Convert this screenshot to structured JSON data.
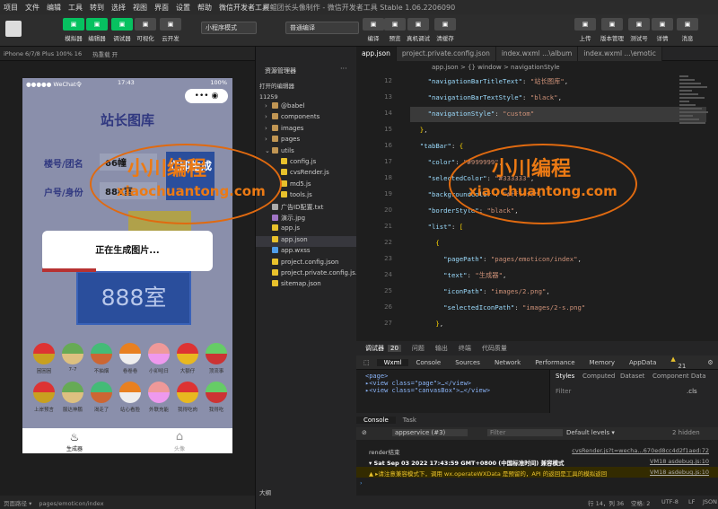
{
  "menu": [
    "项目",
    "文件",
    "编辑",
    "工具",
    "转到",
    "选择",
    "视图",
    "界面",
    "设置",
    "帮助",
    "微信开发者工具"
  ],
  "window_title": "腥鲲团长头像制作 - 微信开发者工具 Stable 1.06.2206090",
  "toolbar": {
    "left": [
      "模拟器",
      "编辑器",
      "调试器",
      "可视化",
      "云开发"
    ],
    "mode_select": "小程序模式",
    "compile_select": "普通编译",
    "center": [
      "编译",
      "预览",
      "真机调试",
      "清缓存"
    ],
    "right": [
      "上传",
      "版本管理",
      "测试号",
      "详情",
      "消息"
    ]
  },
  "simulator": {
    "device": "iPhone 6/7/8 Plus 100% 16",
    "hot_reload": "热重载 开",
    "status": {
      "carrier": "●●●●● WeChat令",
      "time": "17:43",
      "battery": "100%"
    },
    "page_title": "站长图库",
    "field1": {
      "label": "楼号/团名",
      "value": "66幢"
    },
    "field2": {
      "label": "户号/身份",
      "value": "888室"
    },
    "generate_button": "立即生成",
    "preview_text": "888室",
    "toast_text": "正在生成图片...",
    "emoji_row1": [
      "困困困",
      "7-7",
      "不抽烟",
      "卷卷卷",
      "小卯哈日",
      "大额仔",
      "顶流事"
    ],
    "emoji_row2": [
      "上岸预言",
      "服达神鹏",
      "渴走了",
      "站心看脸",
      "外联充能",
      "我得吃肉",
      "我得吃"
    ],
    "tab_left": "生成器",
    "tab_right": "头像"
  },
  "sim_footer": {
    "path_label": "页面路径 ▾",
    "path": "pages/emoticon/index"
  },
  "explorer": {
    "title": "资源管理器",
    "open_editors": "打开的编辑器",
    "root": "11259",
    "items": [
      {
        "name": "@babel",
        "type": "folder",
        "indent": 1
      },
      {
        "name": "components",
        "type": "folder",
        "indent": 1
      },
      {
        "name": "images",
        "type": "folder",
        "indent": 1
      },
      {
        "name": "pages",
        "type": "folder",
        "indent": 1
      },
      {
        "name": "utils",
        "type": "folder-open",
        "indent": 1
      },
      {
        "name": "config.js",
        "type": "js",
        "indent": 2
      },
      {
        "name": "cvsRender.js",
        "type": "js",
        "indent": 2
      },
      {
        "name": "md5.js",
        "type": "js",
        "indent": 2
      },
      {
        "name": "tools.js",
        "type": "js",
        "indent": 2
      },
      {
        "name": "广告ID配置.txt",
        "type": "txt",
        "indent": 1
      },
      {
        "name": "演示.jpg",
        "type": "img",
        "indent": 1
      },
      {
        "name": "app.js",
        "type": "js",
        "indent": 1
      },
      {
        "name": "app.json",
        "type": "json",
        "indent": 1
      },
      {
        "name": "app.wxss",
        "type": "wxss",
        "indent": 1
      },
      {
        "name": "project.config.json",
        "type": "json",
        "indent": 1
      },
      {
        "name": "project.private.config.js...",
        "type": "json",
        "indent": 1
      },
      {
        "name": "sitemap.json",
        "type": "json",
        "indent": 1
      }
    ],
    "outline": "大纲"
  },
  "editor": {
    "tabs": [
      "app.json",
      "project.private.config.json",
      "index.wxml  ...\\album",
      "index.wxml  ...\\emotic"
    ],
    "breadcrumb": "app.json > {} window > navigationStyle",
    "line_numbers": [
      "12",
      "13",
      "14",
      "15",
      "16",
      "17",
      "18",
      "19",
      "20",
      "21",
      "22",
      "23",
      "24",
      "25",
      "26",
      "27"
    ],
    "lines": [
      "    \"navigationBarTitleText\": \"站长图库\",",
      "    \"navigationBarTextStyle\": \"black\",",
      "    \"navigationStyle\": \"custom\"",
      "  },",
      "  \"tabBar\": {",
      "    \"color\": \"#999999\",",
      "    \"selectedColor\": \"#333333\",",
      "    \"backgroundColor\": \"#ffffff\",",
      "    \"borderStyle\": \"black\",",
      "    \"list\": [",
      "      {",
      "        \"pagePath\": \"pages/emoticon/index\",",
      "        \"text\": \"生成器\",",
      "        \"iconPath\": \"images/2.png\",",
      "        \"selectedIconPath\": \"images/2-s.png\"",
      "      },"
    ]
  },
  "devtools": {
    "tabs": [
      "调试器",
      "问题",
      "输出",
      "终端",
      "代码质量"
    ],
    "badge": "20",
    "subtabs": [
      "Wxml",
      "Console",
      "Sources",
      "Network",
      "Performance",
      "Memory",
      "AppData"
    ],
    "warn_count": "21",
    "elements": [
      "<page>",
      "▸<view class=\"page\">…</view>",
      "▸<view class=\"canvasBox\">…</view>"
    ],
    "style_tabs": [
      "Styles",
      "Computed",
      "Dataset",
      "Component Data"
    ],
    "filter": "Filter",
    "cls": ".cls"
  },
  "console": {
    "tabs": [
      "Console",
      "Task"
    ],
    "context": "appservice (#3)",
    "filter": "Filter",
    "levels": "Default levels ▾",
    "hidden": "2 hidden",
    "lines": [
      {
        "text": "render结束",
        "src": "cvsRender.js?t=wecha…670ed8cc4d2f1aed:72",
        "kind": "log"
      },
      {
        "text": "▾ Sat Sep 03 2022 17:43:59 GMT+0800 (中国标准时间) 兼容模式",
        "src": "VM18 asdebug.js:10",
        "kind": "head"
      },
      {
        "text": "▲ ▸请注意兼容模式下，调用 wx.operateWXData 是预留的，API 的返回是工具的模拟返回",
        "src": "VM18 asdebug.js:10",
        "kind": "warn"
      }
    ]
  },
  "status_right": [
    "行 14，列 36",
    "空格: 2",
    "UTF-8",
    "LF",
    "JSON"
  ],
  "watermark": {
    "cn": "小川编程",
    "en": "xiaochuantong.com"
  },
  "colors": {
    "accent": "#07c160",
    "watermark": "#ec7a14",
    "phone_bg": "#8a8fab",
    "button": "#2a4e9c"
  }
}
